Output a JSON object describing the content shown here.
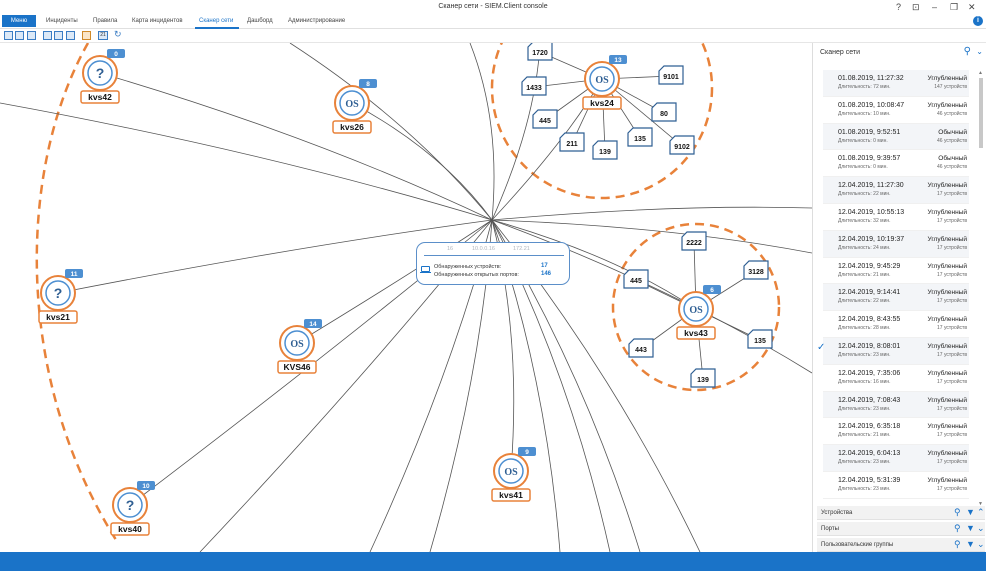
{
  "window": {
    "title": "Сканер сети - SIEM.Client console",
    "controls": [
      "?",
      "⊡",
      "–",
      "❐",
      "✕"
    ]
  },
  "menu": {
    "menu_button": "Меню",
    "items": [
      "Инциденты",
      "Правила",
      "Карта инцидентов",
      "Сканер сети",
      "Дашборд",
      "Администрирование"
    ],
    "active_index": 3,
    "info_icon": "info-icon"
  },
  "toolbar": {
    "icons": [
      "grid-view-icon",
      "list-view-icon",
      "table-view-icon",
      "export-icon",
      "import-icon",
      "print-icon",
      "settings-icon",
      "calendar-icon",
      "refresh-icon"
    ],
    "calendar_label": "21"
  },
  "map": {
    "info_box": {
      "ticks": [
        "16",
        "10.0.0.16",
        "172.21"
      ],
      "discovered_devices_label": "Обнаруженных устройств:",
      "discovered_devices_value": "17",
      "open_ports_label": "Обнаруженных открытых портов:",
      "open_ports_value": "146"
    },
    "hosts": [
      {
        "name": "kvs42",
        "icon": "question-icon",
        "badge": "0"
      },
      {
        "name": "kvs26",
        "icon": "os-icon",
        "badge": "8"
      },
      {
        "name": "kvs24",
        "icon": "os-icon",
        "badge": "13"
      },
      {
        "name": "kvs21",
        "icon": "question-icon",
        "badge": "11"
      },
      {
        "name": "KVS46",
        "icon": "os-icon",
        "badge": "14"
      },
      {
        "name": "kvs43",
        "icon": "os-icon",
        "badge": "6"
      },
      {
        "name": "kvs41",
        "icon": "os-icon",
        "badge": "9"
      },
      {
        "name": "kvs40",
        "icon": "question-icon",
        "badge": "10"
      }
    ],
    "ports_kvs24": [
      "1720",
      "1433",
      "445",
      "211",
      "139",
      "135",
      "80",
      "9101",
      "9102"
    ],
    "ports_kvs43": [
      "2222",
      "3128",
      "445",
      "443",
      "139",
      "135"
    ]
  },
  "panel": {
    "title": "Сканер сети",
    "scans": [
      {
        "datetime": "01.08.2019, 11:27:32",
        "duration": "Длительность: 72 мин.",
        "mode": "Углубленный",
        "devices": "147 устройств"
      },
      {
        "datetime": "01.08.2019, 10:08:47",
        "duration": "Длительность: 10 мин.",
        "mode": "Углубленный",
        "devices": "46 устройств"
      },
      {
        "datetime": "01.08.2019, 9:52:51",
        "duration": "Длительность: 0 мин.",
        "mode": "Обычный",
        "devices": "46 устройств"
      },
      {
        "datetime": "01.08.2019, 9:39:57",
        "duration": "Длительность: 0 мин.",
        "mode": "Обычный",
        "devices": "46 устройств"
      },
      {
        "datetime": "12.04.2019, 11:27:30",
        "duration": "Длительность: 22 мин.",
        "mode": "Углубленный",
        "devices": "17 устройств"
      },
      {
        "datetime": "12.04.2019, 10:55:13",
        "duration": "Длительность: 32 мин.",
        "mode": "Углубленный",
        "devices": "17 устройств"
      },
      {
        "datetime": "12.04.2019, 10:19:37",
        "duration": "Длительность: 24 мин.",
        "mode": "Углубленный",
        "devices": "17 устройств"
      },
      {
        "datetime": "12.04.2019, 9:45:29",
        "duration": "Длительность: 21 мин.",
        "mode": "Углубленный",
        "devices": "17 устройств"
      },
      {
        "datetime": "12.04.2019, 9:14:41",
        "duration": "Длительность: 22 мин.",
        "mode": "Углубленный",
        "devices": "17 устройств"
      },
      {
        "datetime": "12.04.2019, 8:43:55",
        "duration": "Длительность: 28 мин.",
        "mode": "Углубленный",
        "devices": "17 устройств"
      },
      {
        "datetime": "12.04.2019, 8:08:01",
        "duration": "Длительность: 23 мин.",
        "mode": "Углубленный",
        "devices": "17 устройств",
        "selected": true
      },
      {
        "datetime": "12.04.2019, 7:35:06",
        "duration": "Длительность: 16 мин.",
        "mode": "Углубленный",
        "devices": "17 устройств"
      },
      {
        "datetime": "12.04.2019, 7:08:43",
        "duration": "Длительность: 23 мин.",
        "mode": "Углубленный",
        "devices": "17 устройств"
      },
      {
        "datetime": "12.04.2019, 6:35:18",
        "duration": "Длительность: 21 мин.",
        "mode": "Углубленный",
        "devices": "17 устройств"
      },
      {
        "datetime": "12.04.2019, 6:04:13",
        "duration": "Длительность: 23 мин.",
        "mode": "Углубленный",
        "devices": "17 устройств"
      },
      {
        "datetime": "12.04.2019, 5:31:39",
        "duration": "Длительность: 23 мин.",
        "mode": "Углубленный",
        "devices": "17 устройств"
      }
    ],
    "sections": [
      "Устройства",
      "Порты",
      "Пользовательские группы"
    ]
  }
}
